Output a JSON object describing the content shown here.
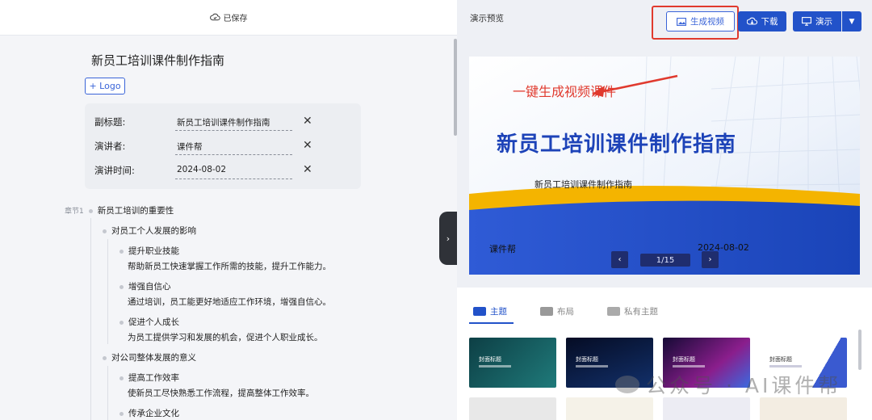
{
  "editor": {
    "save_status": "已保存",
    "doc_title": "新员工培训课件制作指南",
    "add_logo": "+ Logo",
    "meta": [
      {
        "label": "副标题:",
        "value": "新员工培训课件制作指南"
      },
      {
        "label": "演讲者:",
        "value": "课件帮"
      },
      {
        "label": "演讲时间:",
        "value": "2024-08-02"
      }
    ],
    "remove_icon": "✕",
    "chapter_label": "章节1",
    "chapter_title": "新员工培训的重要性",
    "sections": [
      {
        "title": "对员工个人发展的影响",
        "points": [
          {
            "title": "提升职业技能",
            "desc": "帮助新员工快速掌握工作所需的技能，提升工作能力。"
          },
          {
            "title": "增强自信心",
            "desc": "通过培训，员工能更好地适应工作环境，增强自信心。"
          },
          {
            "title": "促进个人成长",
            "desc": "为员工提供学习和发展的机会，促进个人职业成长。"
          }
        ]
      },
      {
        "title": "对公司整体发展的意义",
        "points": [
          {
            "title": "提高工作效率",
            "desc": "使新员工尽快熟悉工作流程，提高整体工作效率。"
          },
          {
            "title": "传承企业文化",
            "desc": ""
          }
        ]
      }
    ],
    "collapse_icon": "›"
  },
  "preview": {
    "title": "演示预览",
    "generate_video": "生成视频",
    "download": "下载",
    "present": "演示",
    "present_dropdown": "▼",
    "annotation": "一键生成视频课件",
    "slide": {
      "title": "新员工培训课件制作指南",
      "subtitle": "新员工培训课件制作指南",
      "presenter": "课件帮",
      "date": "2024-08-02",
      "page": "1/15",
      "prev": "‹",
      "next": "›"
    },
    "tabs": [
      {
        "label": "主题",
        "active": true
      },
      {
        "label": "布局",
        "active": false
      },
      {
        "label": "私有主题",
        "active": false
      }
    ],
    "themes": [
      {
        "label": "封面标题",
        "color": "#0f4f55"
      },
      {
        "label": "封面标题",
        "color": "#0a1230"
      },
      {
        "label": "封面标题",
        "color": "#1a0f3a"
      },
      {
        "label": "封面标题",
        "color": "#f4f6fb"
      }
    ],
    "watermark": "公众号 · AI课件帮"
  },
  "colors": {
    "accent": "#2252c9",
    "annotation": "#e03a2e",
    "slide_title": "#1d43b8"
  }
}
